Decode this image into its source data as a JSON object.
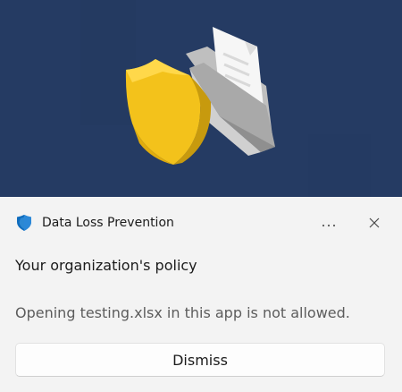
{
  "notification": {
    "app_name": "Data Loss Prevention",
    "app_icon": "shield-icon",
    "more_options_icon": "more-horizontal-icon",
    "close_icon": "close-icon",
    "title": "Your organization's policy",
    "message": "Opening testing.xlsx in this app is not allowed.",
    "dismiss_label": "Dismiss"
  },
  "hero": {
    "icon": "shield-folder-illustration",
    "background_color": "#253b63"
  }
}
